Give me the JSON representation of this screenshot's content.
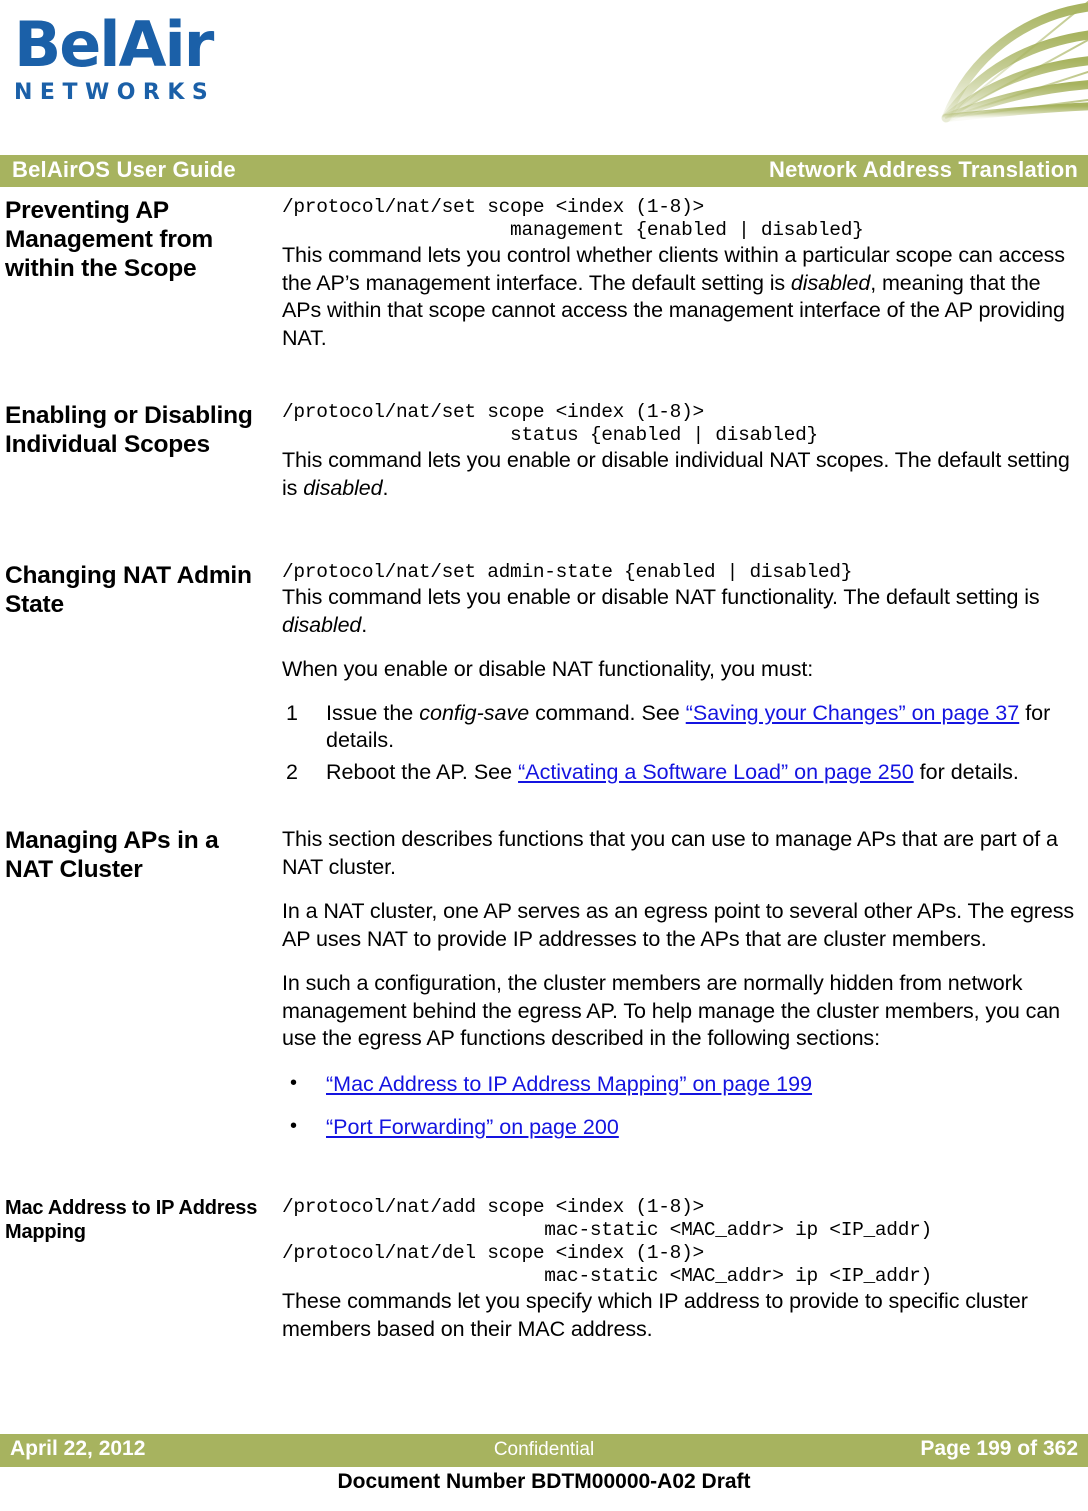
{
  "brand": {
    "logo_wordmark": "BelAir",
    "logo_subtext": "NETWORKS",
    "olive": "#A7B35F",
    "logo_blue": "#1B60A8",
    "link_blue": "#1414E0"
  },
  "header": {
    "left": "BelAirOS User Guide",
    "right": "Network Address Translation"
  },
  "sections": [
    {
      "heading": "Preventing AP Management from within the Scope",
      "code": "/protocol/nat/set scope <index (1-8)>\n                    management {enabled | disabled}",
      "paragraph_a": "This command lets you control whether clients within a particular scope can access the AP’s management interface. The default setting is ",
      "paragraph_a_italic": "disabled",
      "paragraph_a_tail": ", meaning that the APs within that scope cannot access the management interface of the AP providing NAT."
    },
    {
      "heading": "Enabling or Disabling Individual Scopes",
      "code": "/protocol/nat/set scope <index (1-8)>\n                    status {enabled | disabled}",
      "paragraph_a": "This command lets you enable or disable individual NAT scopes. The default setting is ",
      "paragraph_a_italic": "disabled",
      "paragraph_a_tail": "."
    },
    {
      "heading": "Changing NAT Admin State",
      "code": "/protocol/nat/set admin-state {enabled | disabled}",
      "paragraph_a": "This command lets you enable or disable NAT functionality. The default setting is ",
      "paragraph_a_italic": "disabled",
      "paragraph_a_tail": ".",
      "paragraph_b": "When you enable or disable NAT functionality, you must:",
      "steps": [
        {
          "num": "1",
          "pre": "Issue the ",
          "italic": "config-save",
          "mid": " command. See ",
          "link": "“Saving your Changes” on page 37",
          "post": " for details."
        },
        {
          "num": "2",
          "pre": "Reboot the AP. See ",
          "italic": "",
          "mid": "",
          "link": "“Activating a Software Load” on page 250",
          "post": " for details."
        }
      ]
    },
    {
      "heading": "Managing APs in a NAT Cluster",
      "paragraph_a": "This section describes functions that you can use to manage APs that are part of a NAT cluster.",
      "paragraph_b": "In a NAT cluster, one AP serves as an egress point to several other APs. The egress AP uses NAT to provide IP addresses to the APs that are cluster members.",
      "paragraph_c": "In such a configuration, the cluster members are normally hidden from network management behind the egress AP. To help manage the cluster members, you can use the egress AP functions described in the following sections:",
      "bullets": [
        {
          "bullet": "•",
          "link": "“Mac Address to IP Address Mapping” on page 199"
        },
        {
          "bullet": "•",
          "link": "“Port Forwarding” on page 200"
        }
      ]
    },
    {
      "heading": "Mac Address to IP Address Mapping",
      "code": "/protocol/nat/add scope <index (1-8)>\n                       mac-static <MAC_addr> ip <IP_addr)\n/protocol/nat/del scope <index (1-8)>\n                       mac-static <MAC_addr> ip <IP_addr)",
      "paragraph_a": "These commands let you specify which IP address to provide to specific cluster members based on their MAC address."
    }
  ],
  "footer": {
    "date": "April 22, 2012",
    "classification": "Confidential",
    "page": "Page 199 of 362",
    "document_number": "Document Number BDTM00000-A02 Draft"
  }
}
